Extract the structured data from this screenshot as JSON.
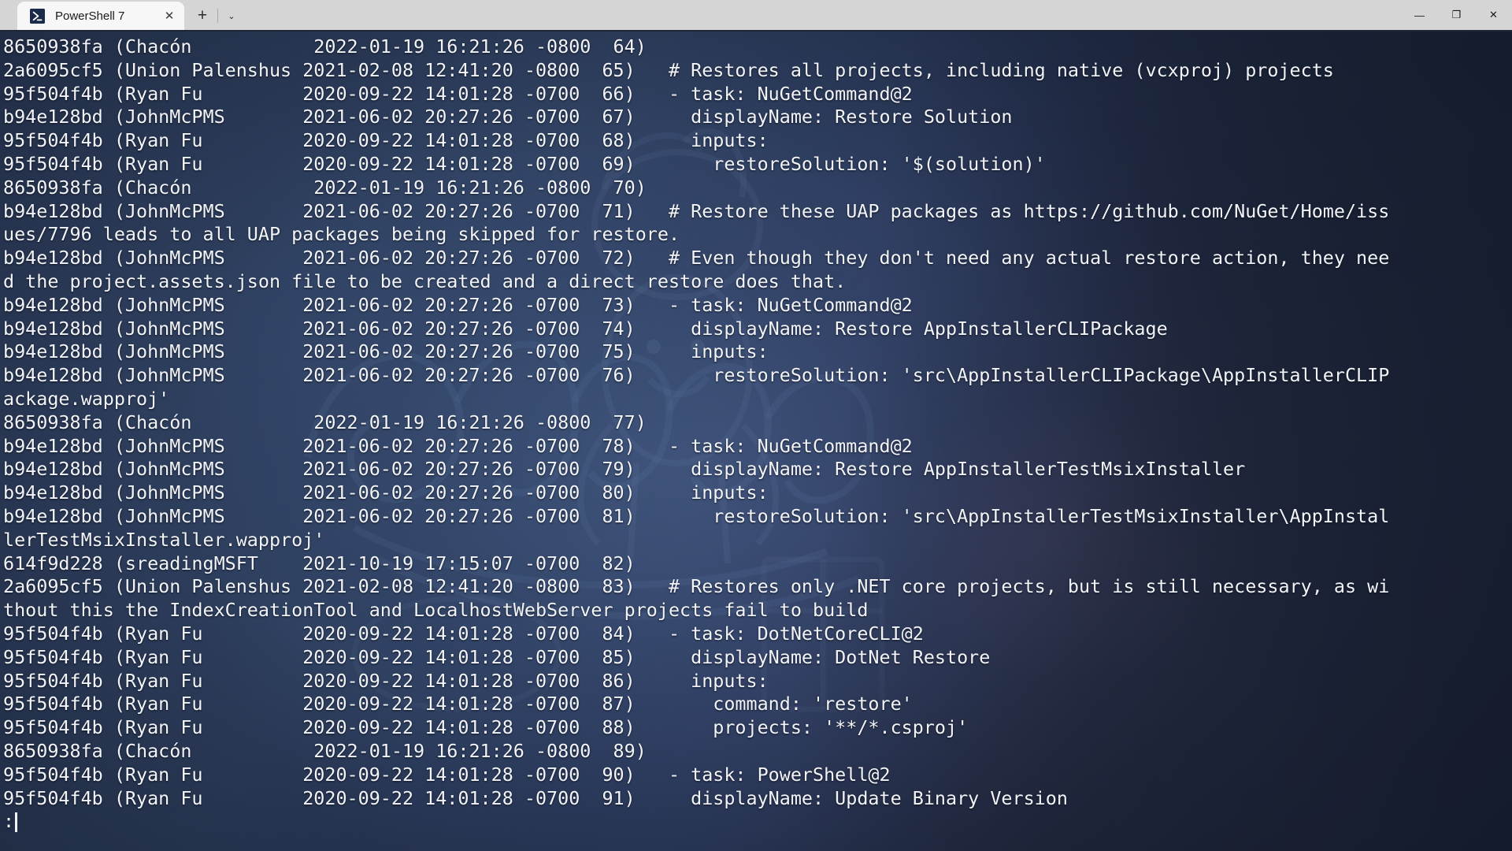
{
  "window": {
    "titlebar_bg": "#d5d5d5",
    "tab": {
      "title": "PowerShell 7",
      "icon": "powershell-icon",
      "close_glyph": "✕"
    },
    "new_tab_glyph": "+",
    "tab_dropdown_glyph": "⌄",
    "controls": {
      "minimize": "—",
      "maximize": "❐",
      "close": "✕"
    }
  },
  "terminal": {
    "background_color": "#1d2639",
    "foreground_color": "#f2f4f8",
    "font_size_px": 23.4,
    "columns": 129,
    "program": "git blame",
    "pager_prompt": ":",
    "cursor": "block-bar-cursor",
    "lines": [
      "8650938fa (Chacón           2022-01-19 16:21:26 -0800  64)",
      "2a6095cf5 (Union Palenshus 2021-02-08 12:41:20 -0800  65)   # Restores all projects, including native (vcxproj) projects",
      "95f504f4b (Ryan Fu         2020-09-22 14:01:28 -0700  66)   - task: NuGetCommand@2",
      "b94e128bd (JohnMcPMS       2021-06-02 20:27:26 -0700  67)     displayName: Restore Solution",
      "95f504f4b (Ryan Fu         2020-09-22 14:01:28 -0700  68)     inputs:",
      "95f504f4b (Ryan Fu         2020-09-22 14:01:28 -0700  69)       restoreSolution: '$(solution)'",
      "8650938fa (Chacón           2022-01-19 16:21:26 -0800  70)",
      "b94e128bd (JohnMcPMS       2021-06-02 20:27:26 -0700  71)   # Restore these UAP packages as https://github.com/NuGet/Home/iss",
      "ues/7796 leads to all UAP packages being skipped for restore.",
      "b94e128bd (JohnMcPMS       2021-06-02 20:27:26 -0700  72)   # Even though they don't need any actual restore action, they nee",
      "d the project.assets.json file to be created and a direct restore does that.",
      "b94e128bd (JohnMcPMS       2021-06-02 20:27:26 -0700  73)   - task: NuGetCommand@2",
      "b94e128bd (JohnMcPMS       2021-06-02 20:27:26 -0700  74)     displayName: Restore AppInstallerCLIPackage",
      "b94e128bd (JohnMcPMS       2021-06-02 20:27:26 -0700  75)     inputs:",
      "b94e128bd (JohnMcPMS       2021-06-02 20:27:26 -0700  76)       restoreSolution: 'src\\AppInstallerCLIPackage\\AppInstallerCLIP",
      "ackage.wapproj'",
      "8650938fa (Chacón           2022-01-19 16:21:26 -0800  77)",
      "b94e128bd (JohnMcPMS       2021-06-02 20:27:26 -0700  78)   - task: NuGetCommand@2",
      "b94e128bd (JohnMcPMS       2021-06-02 20:27:26 -0700  79)     displayName: Restore AppInstallerTestMsixInstaller",
      "b94e128bd (JohnMcPMS       2021-06-02 20:27:26 -0700  80)     inputs:",
      "b94e128bd (JohnMcPMS       2021-06-02 20:27:26 -0700  81)       restoreSolution: 'src\\AppInstallerTestMsixInstaller\\AppInstal",
      "lerTestMsixInstaller.wapproj'",
      "614f9d228 (sreadingMSFT    2021-10-19 17:15:07 -0700  82)",
      "2a6095cf5 (Union Palenshus 2021-02-08 12:41:20 -0800  83)   # Restores only .NET core projects, but is still necessary, as wi",
      "thout this the IndexCreationTool and LocalhostWebServer projects fail to build",
      "95f504f4b (Ryan Fu         2020-09-22 14:01:28 -0700  84)   - task: DotNetCoreCLI@2",
      "95f504f4b (Ryan Fu         2020-09-22 14:01:28 -0700  85)     displayName: DotNet Restore",
      "95f504f4b (Ryan Fu         2020-09-22 14:01:28 -0700  86)     inputs:",
      "95f504f4b (Ryan Fu         2020-09-22 14:01:28 -0700  87)       command: 'restore'",
      "95f504f4b (Ryan Fu         2020-09-22 14:01:28 -0700  88)       projects: '**/*.csproj'",
      "8650938fa (Chacón           2022-01-19 16:21:26 -0800  89)",
      "95f504f4b (Ryan Fu         2020-09-22 14:01:28 -0700  90)   - task: PowerShell@2",
      "95f504f4b (Ryan Fu         2020-09-22 14:01:28 -0700  91)     displayName: Update Binary Version"
    ]
  }
}
